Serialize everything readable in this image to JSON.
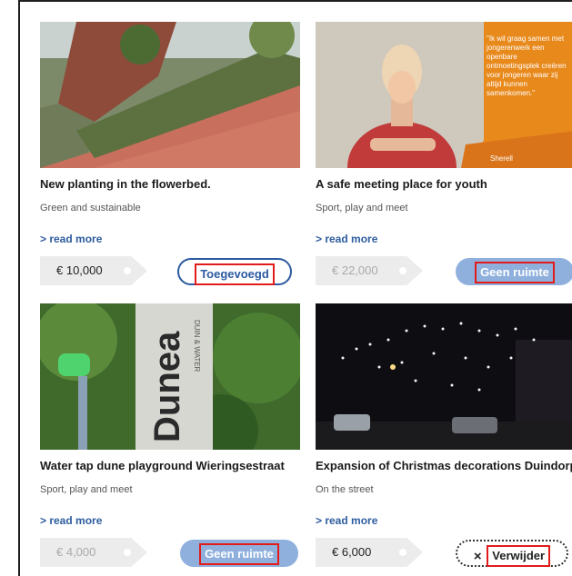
{
  "projects": [
    {
      "title": "New planting in the flowerbed.",
      "category": "Green and sustainable",
      "read_more": "> read more",
      "price": "€ 10,000",
      "button": "Toegevoegd"
    },
    {
      "title": "A safe meeting place for youth",
      "category": "Sport, play and meet",
      "read_more": "> read more",
      "price": "€ 22,000",
      "button": "Geen ruimte",
      "image_quote": "\"Ik wil graag samen met jongerenwerk een openbare ontmoetingsplek creëren voor jongeren waar zij altijd kunnen samenkomen.\"",
      "image_name": "Sherell"
    },
    {
      "title": "Water tap dune playground Wieringsestraat",
      "category": "Sport, play and meet",
      "read_more": "> read more",
      "price": "€ 4,000",
      "button": "Geen ruimte",
      "image_sign": "Dunea",
      "image_sign_sub": "DUIN & WATER"
    },
    {
      "title": "Expansion of Christmas decorations Duindorp",
      "category": "On the street",
      "read_more": "> read more",
      "price": "€ 6,000",
      "button": "Verwijder",
      "remove_icon": "×"
    }
  ]
}
